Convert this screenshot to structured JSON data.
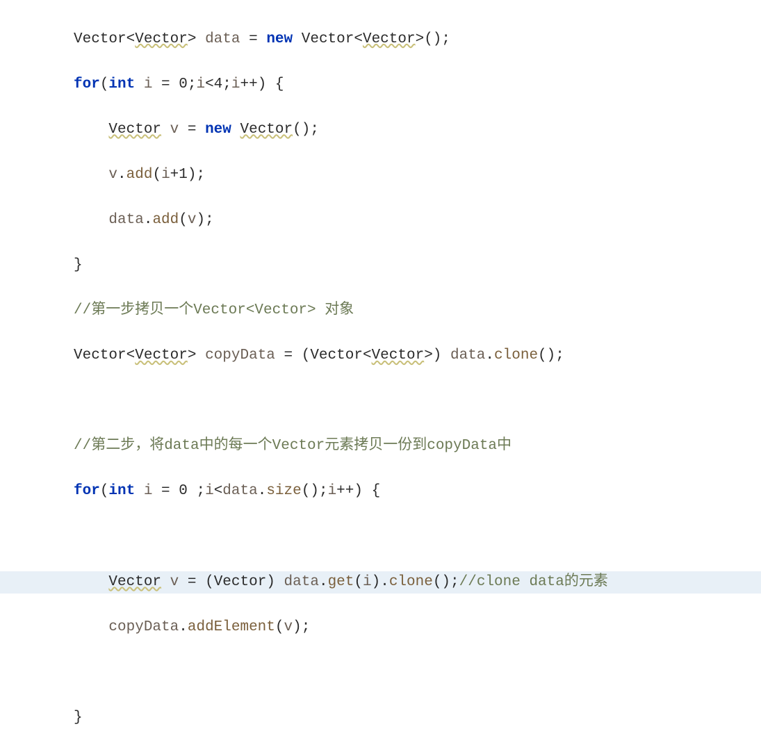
{
  "code": {
    "l1": {
      "type": "Vector",
      "gen": "<",
      "genType": "Vector",
      "genClose": "> ",
      "ident": "data",
      "eq": " = ",
      "kwNew": "new",
      "post": " ",
      "type2": "Vector",
      "gen2": "<",
      "genType2": "Vector",
      "genClose2": ">();"
    },
    "l2": {
      "kwFor": "for",
      "open": "(",
      "kwInt": "int",
      "sp": " ",
      "ident": "i",
      "rest": " = 0;",
      "ident2": "i",
      "cmp": "<4;",
      "ident3": "i",
      "inc": "++) {"
    },
    "l3": {
      "pad": "    ",
      "type": "Vector",
      "sp": " ",
      "ident": "v",
      "eq": " = ",
      "kwNew": "new",
      "sp2": " ",
      "type2": "Vector",
      "tail": "();"
    },
    "l4": {
      "pad": "    ",
      "ident": "v",
      "dot": ".",
      "method": "add",
      "open": "(",
      "arg": "i",
      "rest": "+1);"
    },
    "l5": {
      "pad": "    ",
      "ident": "data",
      "dot": ".",
      "method": "add",
      "open": "(",
      "arg": "v",
      "close": ");"
    },
    "l6": {
      "brace": "}"
    },
    "l7": {
      "comment": "//第一步拷贝一个Vector<Vector> 对象"
    },
    "l8": {
      "type": "Vector",
      "gen": "<",
      "genType": "Vector",
      "genClose": "> ",
      "ident": "copyData",
      "eq": " = (",
      "castType": "Vector",
      "castGen": "<",
      "castGenType": "Vector",
      "castClose": ">) ",
      "src": "data",
      "dot": ".",
      "method": "clone",
      "tail": "();"
    },
    "l9": {
      "blank": " "
    },
    "l10": {
      "comment": "//第二步，将data中的每一个Vector元素拷贝一份到copyData中"
    },
    "l11": {
      "kwFor": "for",
      "open": "(",
      "kwInt": "int",
      "sp": " ",
      "ident": "i",
      "rest": " = 0 ;",
      "ident2": "i",
      "lt": "<",
      "src": "data",
      "dot": ".",
      "method": "size",
      "rest2": "();",
      "ident3": "i",
      "inc": "++) {"
    },
    "l12": {
      "blank": " "
    },
    "l13": {
      "pad": "    ",
      "type": "Vector",
      "sp": " ",
      "ident": "v",
      "eq": " = (",
      "castType": "Vector",
      "castClose": ") ",
      "src": "data",
      "dot": ".",
      "method1": "get",
      "open": "(",
      "arg": "i",
      "close": ").",
      "method2": "clone",
      "tail": "();",
      "comment": "//clone data的元素"
    },
    "l14": {
      "pad": "    ",
      "ident": "copyData",
      "dot": ".",
      "method": "addElement",
      "open": "(",
      "arg": "v",
      "close": ");"
    },
    "l15": {
      "blank": " "
    },
    "l16": {
      "brace": "}"
    }
  }
}
